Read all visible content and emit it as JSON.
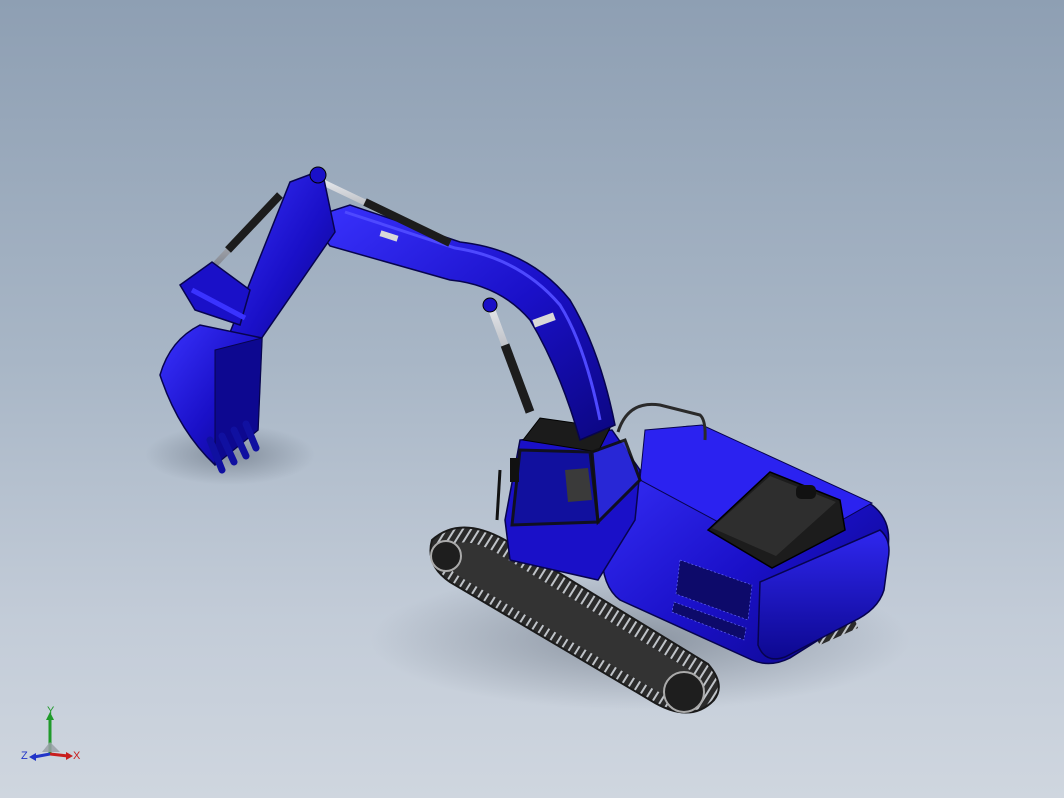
{
  "viewport": {
    "background_top": "#8e9fb3",
    "background_bottom": "#cfd6df"
  },
  "model": {
    "body_color": "#1a10c8",
    "body_dark": "#0b0680",
    "track_color": "#2a2a2a",
    "cylinder_color": "#b8bcc4"
  },
  "triad": {
    "x_label": "X",
    "y_label": "Y",
    "z_label": "Z",
    "x_color": "#c81e1e",
    "y_color": "#1f9a2a",
    "z_color": "#2235c8"
  }
}
